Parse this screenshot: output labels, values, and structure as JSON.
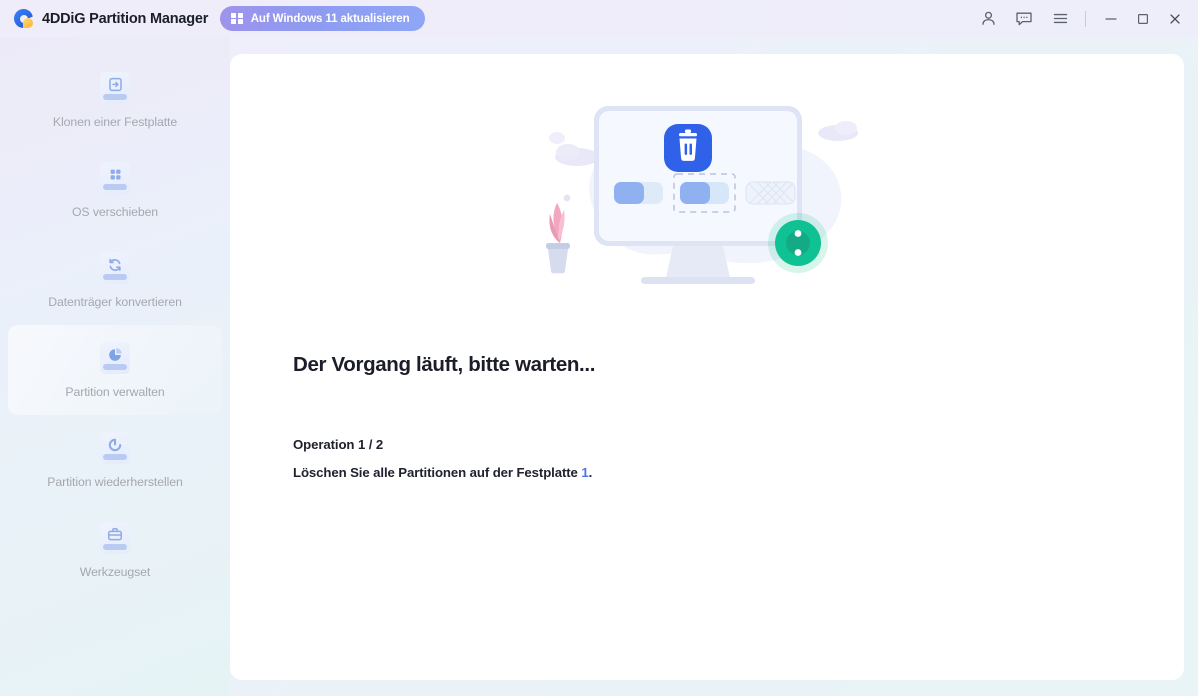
{
  "window": {
    "app_title": "4DDiG Partition Manager",
    "logo_icon": "4ddig-logo-icon",
    "upgrade_button": {
      "label": "Auf Windows 11 aktualisieren",
      "icon": "windows-logo-icon",
      "gradient_from": "#9e93ec",
      "gradient_to": "#8fa6f6"
    },
    "system_icons": [
      {
        "name": "account-icon",
        "glyph": "person"
      },
      {
        "name": "feedback-icon",
        "glyph": "chat-bubble"
      },
      {
        "name": "menu-icon",
        "glyph": "hamburger"
      }
    ],
    "window_controls": [
      {
        "name": "minimize-button",
        "glyph": "minimize"
      },
      {
        "name": "maximize-button",
        "glyph": "maximize"
      },
      {
        "name": "close-button",
        "glyph": "close"
      }
    ],
    "titlebar_background": "#eeedf9"
  },
  "sidebar": {
    "background_from": "#eceaf8",
    "background_to": "#e6f3f5",
    "label_color": "#a4a8ae",
    "items": [
      {
        "label": "Klonen einer Festplatte",
        "icon": "clone-disk-icon",
        "active": false
      },
      {
        "label": "OS verschieben",
        "icon": "migrate-os-icon",
        "active": false
      },
      {
        "label": "Datenträger konvertieren",
        "icon": "convert-disk-icon",
        "active": false
      },
      {
        "label": "Partition verwalten",
        "icon": "manage-partition-icon",
        "active": true
      },
      {
        "label": "Partition wiederherstellen",
        "icon": "recover-partition-icon",
        "active": false
      },
      {
        "label": "Werkzeugset",
        "icon": "toolkit-icon",
        "active": false
      }
    ]
  },
  "main": {
    "illustration": {
      "name": "deleting-partitions-illustration",
      "monitor_screen_color": "#f4f7ff",
      "trash_badge_color": "#2f62e8",
      "spinner_color": "#0dbf8a",
      "plant_color": "#f2a7bf"
    },
    "headline": "Der Vorgang läuft, bitte warten...",
    "operation_line": "Operation 1 / 2",
    "detail_prefix": "Löschen Sie alle Partitionen auf der Festplatte ",
    "detail_accent": "1",
    "detail_suffix": ".",
    "accent_color": "#4f74ea",
    "panel_background": "#ffffff"
  }
}
